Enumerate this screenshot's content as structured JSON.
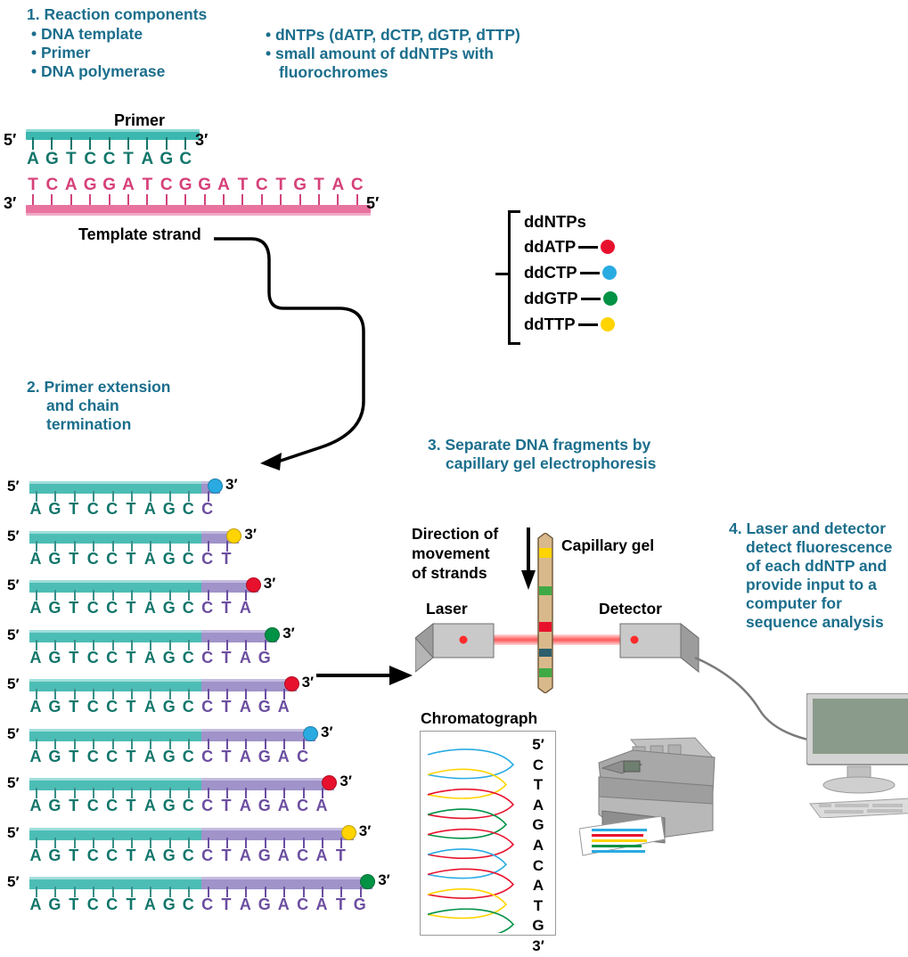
{
  "steps": {
    "step1": {
      "title": "1. Reaction components",
      "col1": [
        "• DNA template",
        "• Primer",
        "• DNA polymerase"
      ],
      "col2_line1": "• dNTPs (dATP, dCTP, dGTP, dTTP)",
      "col2_line2": "• small amount of ddNTPs with",
      "col2_line3": "fluorochromes"
    },
    "step2": {
      "line1": "2. Primer extension",
      "line2": "and chain",
      "line3": "termination"
    },
    "step3": {
      "line1": "3. Separate DNA fragments by",
      "line2": "capillary gel electrophoresis"
    },
    "step4": {
      "line1": "4. Laser and detector",
      "line2": "detect fluorescence",
      "line3": "of each ddNTP and",
      "line4": "provide input to a",
      "line5": "computer for",
      "line6": "sequence analysis"
    }
  },
  "duplex": {
    "primer_label": "Primer",
    "template_label": "Template strand",
    "primer_five": "5′",
    "primer_three": "3′",
    "template_three": "3′",
    "template_five": "5′",
    "primer_bases": [
      "A",
      "G",
      "T",
      "C",
      "C",
      "T",
      "A",
      "G",
      "C"
    ],
    "template_bases": [
      "T",
      "C",
      "A",
      "G",
      "G",
      "A",
      "T",
      "C",
      "G",
      "G",
      "A",
      "T",
      "C",
      "T",
      "G",
      "T",
      "A",
      "C"
    ]
  },
  "ddntps": {
    "title": "ddNTPs",
    "items": [
      {
        "label": "ddATP",
        "color": "#e8112d"
      },
      {
        "label": "ddCTP",
        "color": "#29abe2"
      },
      {
        "label": "ddGTP",
        "color": "#009245"
      },
      {
        "label": "ddTTP",
        "color": "#ffd400"
      }
    ]
  },
  "ladder": {
    "five_label": "5′",
    "three_label": "3′",
    "primer_sequence": "AGTCCTAGC",
    "fragments": [
      {
        "extension": "C",
        "terminator": "ddCTP",
        "color": "#29abe2"
      },
      {
        "extension": "CT",
        "terminator": "ddTTP",
        "color": "#ffd400"
      },
      {
        "extension": "CTA",
        "terminator": "ddATP",
        "color": "#e8112d"
      },
      {
        "extension": "CTAG",
        "terminator": "ddGTP",
        "color": "#009245"
      },
      {
        "extension": "CTAGA",
        "terminator": "ddATP",
        "color": "#e8112d"
      },
      {
        "extension": "CTAGAC",
        "terminator": "ddCTP",
        "color": "#29abe2"
      },
      {
        "extension": "CTAGACA",
        "terminator": "ddATP",
        "color": "#e8112d"
      },
      {
        "extension": "CTAGACAT",
        "terminator": "ddTTP",
        "color": "#ffd400"
      },
      {
        "extension": "CTAGACATG",
        "terminator": "ddGTP",
        "color": "#009245"
      }
    ]
  },
  "electrophoresis": {
    "direction_line1": "Direction of",
    "direction_line2": "movement",
    "direction_line3": "of strands",
    "capillary_label": "Capillary gel",
    "laser_label": "Laser",
    "detector_label": "Detector",
    "gel_bands": [
      {
        "color": "#ffd400",
        "pos": 17
      },
      {
        "color": "#009245",
        "pos": 37
      },
      {
        "color": "#e8112d",
        "pos": 57
      },
      {
        "color": "#1b6e8c",
        "pos": 74
      },
      {
        "color": "#009245",
        "pos": 87
      }
    ]
  },
  "chromatograph": {
    "title": "Chromatograph",
    "five": "5′",
    "three": "3′",
    "bases": [
      "C",
      "T",
      "A",
      "G",
      "A",
      "C",
      "A",
      "T",
      "G"
    ],
    "peak_colors": [
      "#29abe2",
      "#ffd400",
      "#e8112d",
      "#009245",
      "#e8112d",
      "#29abe2",
      "#e8112d",
      "#ffd400",
      "#009245"
    ]
  },
  "colors": {
    "heading_teal": "#1b6e8c",
    "primer_teal": "#4cbdb5",
    "extension_purple": "#9f93c9",
    "template_pink": "#e8739f"
  }
}
